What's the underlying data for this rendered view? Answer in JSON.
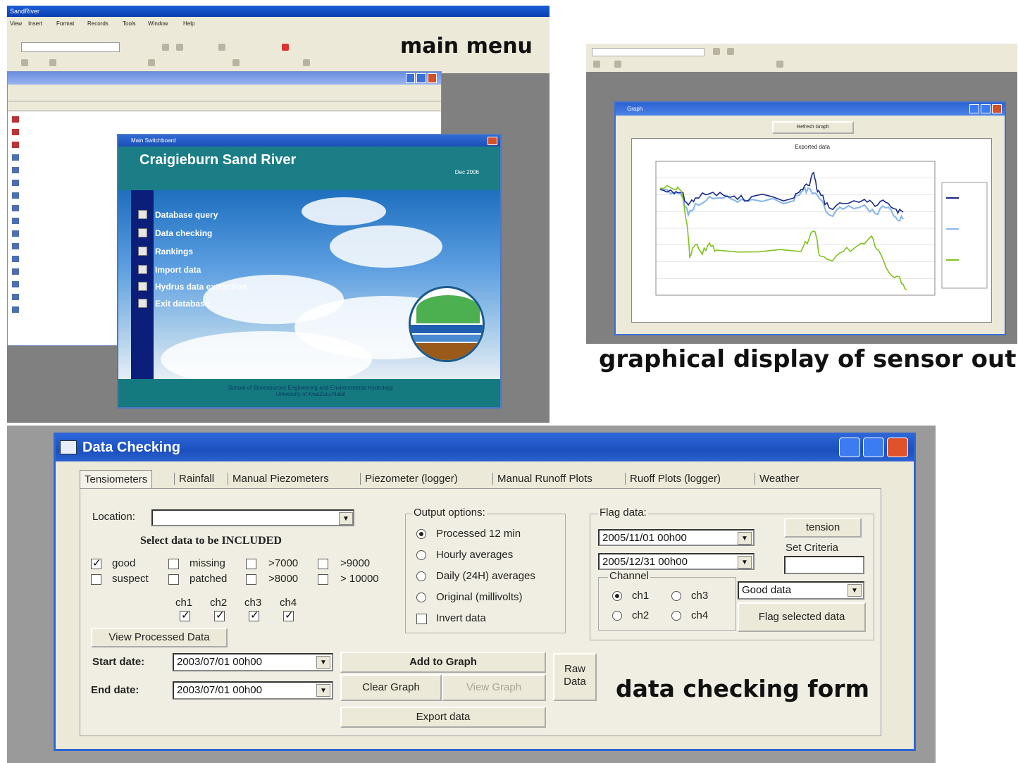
{
  "captions": {
    "main_menu": "main menu",
    "graph": "graphical display of sensor output",
    "form": "data checking form"
  },
  "main_menu_panel": {
    "app_title": "SandRiver",
    "switchboard": {
      "title": "Main Switchboard",
      "heading": "Craigieburn Sand River",
      "date": "Dec 2006",
      "items": [
        "Database query",
        "Data checking",
        "Rankings",
        "Import data",
        "Hydrus data extraction",
        "Exit database"
      ],
      "footer_line1": "School of Bioresources Engineering and Environmental Hydrology",
      "footer_line2": "University of KwaZulu-Natal"
    }
  },
  "graph_panel": {
    "window_title": "Graph",
    "refresh_label": "Refresh Graph",
    "chart_title": "Exported data"
  },
  "chart_data": {
    "type": "line",
    "title": "Exported data",
    "series": [
      {
        "color": "#1a2a8a"
      },
      {
        "color": "#8ab8ea"
      },
      {
        "color": "#7fc21c"
      }
    ],
    "grid": true,
    "legend": "right"
  },
  "form": {
    "title": "Data Checking",
    "tabs": [
      "Tensiometers",
      "Rainfall",
      "Manual Piezometers",
      "Piezometer (logger)",
      "Manual Runoff Plots",
      "Ruoff Plots (logger)",
      "Weather"
    ],
    "location_label": "Location:",
    "location_value": "",
    "select_heading": "Select data to be INCLUDED",
    "checks": [
      {
        "label": "good",
        "checked": true
      },
      {
        "label": "missing",
        "checked": false
      },
      {
        "label": ">7000",
        "checked": false
      },
      {
        "label": ">9000",
        "checked": false
      },
      {
        "label": "suspect",
        "checked": false
      },
      {
        "label": "patched",
        "checked": false
      },
      {
        "label": ">8000",
        "checked": false
      },
      {
        "label": "> 10000",
        "checked": false
      }
    ],
    "channels": [
      "ch1",
      "ch2",
      "ch3",
      "ch4"
    ],
    "view_processed": "View Processed Data",
    "start_label": "Start date:",
    "start_value": "2003/07/01  00h00",
    "end_label": "End date:",
    "end_value": "2003/07/01  00h00",
    "add_graph": "Add to Graph",
    "clear_graph": "Clear Graph",
    "view_graph": "View Graph",
    "raw_data": "Raw Data",
    "export_data": "Export data",
    "output_options_label": "Output options:",
    "output_options": [
      "Processed 12 min",
      "Hourly averages",
      "Daily (24H) averages",
      "Original (millivolts)"
    ],
    "invert_data": "Invert data",
    "flag_label": "Flag data:",
    "flag_from": "2005/11/01  00h00",
    "flag_to": "2005/12/31  00h00",
    "tension_btn": "tension",
    "set_criteria": "Set Criteria",
    "set_criteria_value": "",
    "channel_label": "Channel",
    "flag_channels": [
      "ch1",
      "ch3",
      "ch2",
      "ch4"
    ],
    "flag_status": "Good data",
    "flag_selected": "Flag selected data"
  }
}
